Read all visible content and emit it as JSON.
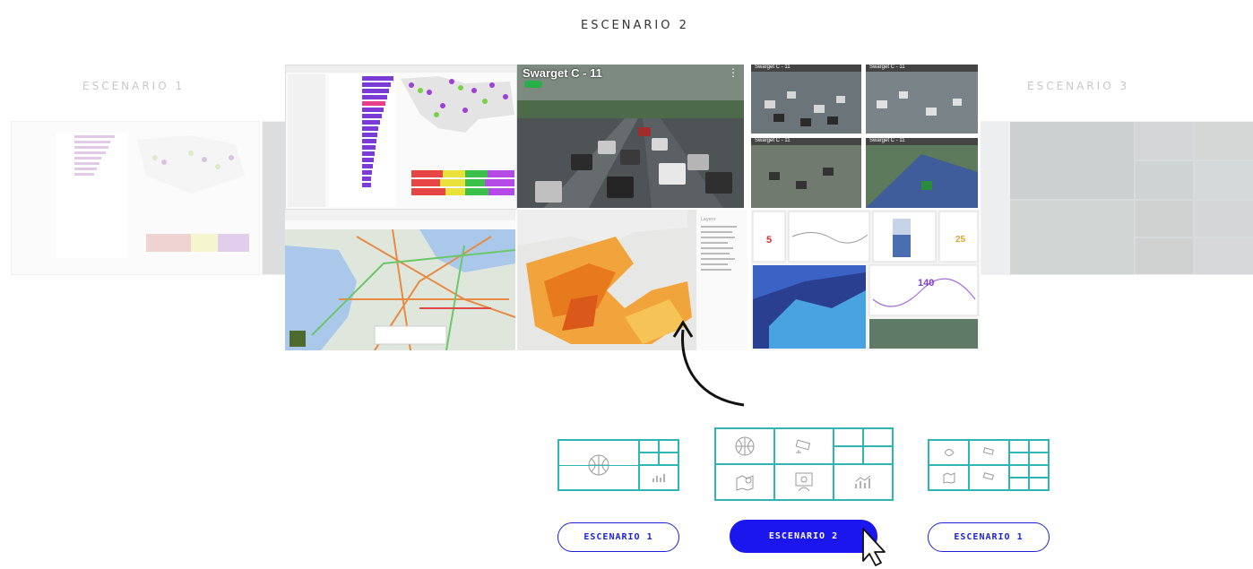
{
  "scenarios": {
    "main_title": "ESCENARIO 2",
    "left_title": "ESCENARIO 1",
    "right_title": "ESCENARIO 3"
  },
  "camera": {
    "main_label": "Swarget C - 11",
    "grid_labels": [
      "Swarget C - 11",
      "Swarget C - 11",
      "Swarget C - 11",
      "Swarget C - 11"
    ]
  },
  "dashboard": {
    "metric_left": "5",
    "metric_right": "25",
    "metric_chart": "140"
  },
  "buttons": {
    "left": "ESCENARIO 1",
    "center": "ESCENARIO 2",
    "right": "ESCENARIO 1"
  },
  "icons": {
    "globe": "globe-icon",
    "camera": "cctv-camera-icon",
    "map": "map-pin-icon",
    "dashboard": "dashboard-person-icon",
    "chart": "bar-chart-icon",
    "cursor": "pointer-cursor-icon"
  },
  "colors": {
    "accent": "#1b15ee",
    "layout_border": "#2fb6b3",
    "live_dot": "#27b047"
  }
}
